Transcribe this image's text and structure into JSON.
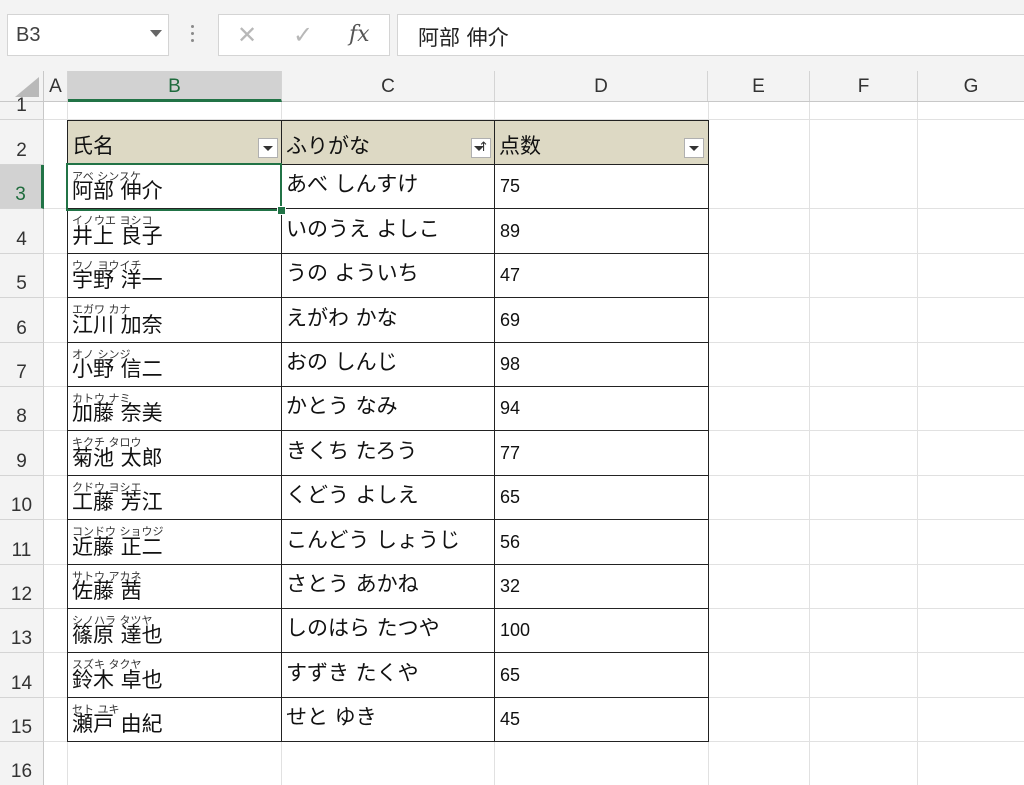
{
  "formula_bar": {
    "name_box": "B3",
    "cancel_icon": "✕",
    "enter_icon": "✓",
    "fx_icon": "fx",
    "formula": "阿部 伸介"
  },
  "columns": [
    "A",
    "B",
    "C",
    "D",
    "E",
    "F",
    "G"
  ],
  "selected_column": "B",
  "selected_row": "3",
  "table": {
    "headers": [
      "氏名",
      "ふりがな",
      "点数"
    ],
    "rows": [
      {
        "row": "3",
        "furigana": "アベ シンスケ",
        "name": "阿部 伸介",
        "kana": "あべ しんすけ",
        "score": "75"
      },
      {
        "row": "4",
        "furigana": "イノウエ ヨシコ",
        "name": "井上 良子",
        "kana": "いのうえ よしこ",
        "score": "89"
      },
      {
        "row": "5",
        "furigana": "ウノ ヨウイチ",
        "name": "宇野 洋一",
        "kana": "うの よういち",
        "score": "47"
      },
      {
        "row": "6",
        "furigana": "エガワ カナ",
        "name": "江川 加奈",
        "kana": "えがわ かな",
        "score": "69"
      },
      {
        "row": "7",
        "furigana": "オノ シンジ",
        "name": "小野 信二",
        "kana": "おの しんじ",
        "score": "98"
      },
      {
        "row": "8",
        "furigana": "カトウ ナミ",
        "name": "加藤 奈美",
        "kana": "かとう なみ",
        "score": "94"
      },
      {
        "row": "9",
        "furigana": "キクチ タロウ",
        "name": "菊池 太郎",
        "kana": "きくち たろう",
        "score": "77"
      },
      {
        "row": "10",
        "furigana": "クドウ ヨシエ",
        "name": "工藤 芳江",
        "kana": "くどう よしえ",
        "score": "65"
      },
      {
        "row": "11",
        "furigana": "コンドウ ショウジ",
        "name": "近藤 正二",
        "kana": "こんどう しょうじ",
        "score": "56"
      },
      {
        "row": "12",
        "furigana": "サトウ アカネ",
        "name": "佐藤 茜",
        "kana": "さとう あかね",
        "score": "32"
      },
      {
        "row": "13",
        "furigana": "シノハラ タツヤ",
        "name": "篠原 達也",
        "kana": "しのはら たつや",
        "score": "100"
      },
      {
        "row": "14",
        "furigana": "スズキ タクヤ",
        "name": "鈴木 卓也",
        "kana": "すずき たくや",
        "score": "65"
      },
      {
        "row": "15",
        "furigana": "セト ユキ",
        "name": "瀬戸 由紀",
        "kana": "せと ゆき",
        "score": "45"
      }
    ]
  },
  "extra_rows": [
    "1",
    "2",
    "16"
  ],
  "colors": {
    "accent": "#217346",
    "header_fill": "#ddd9c4"
  }
}
